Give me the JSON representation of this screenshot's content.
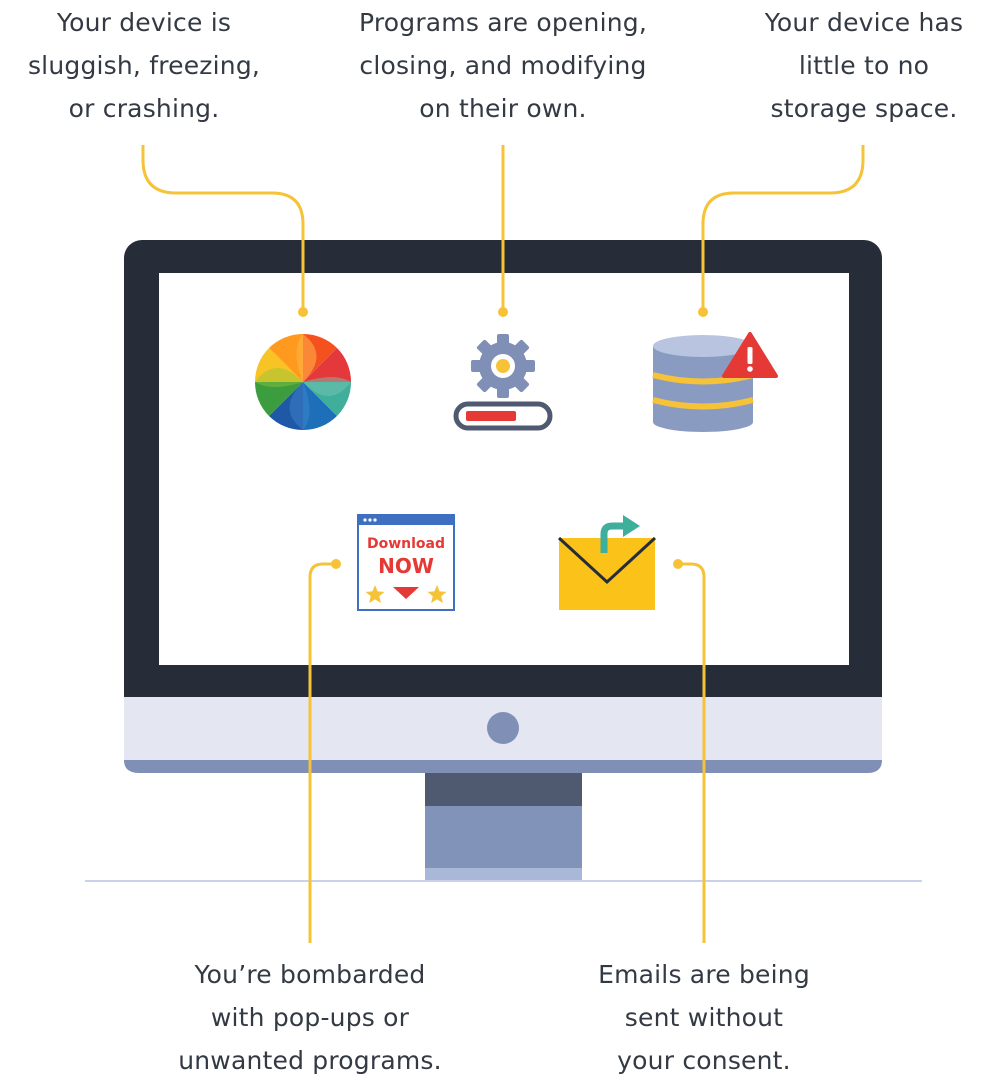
{
  "captions": {
    "slow": [
      "Your device is",
      "sluggish, freezing,",
      "or crashing."
    ],
    "programs": [
      "Programs are opening,",
      "closing, and modifying",
      "on their own."
    ],
    "storage": [
      "Your device has",
      "little to no",
      "storage space."
    ],
    "popups": [
      "You’re bombarded",
      "with pop-ups or",
      "unwanted programs."
    ],
    "emails": [
      "Emails are being",
      "sent without",
      "your consent."
    ]
  },
  "popup_window": {
    "line1": "Download",
    "line2": "NOW"
  },
  "icons": {
    "slow": "spinning-wheel-icon",
    "programs": "gear-progress-icon",
    "storage": "database-warning-icon",
    "popups": "download-popup-icon",
    "emails": "envelope-forward-icon"
  },
  "colors": {
    "leader_line": "#f6c338",
    "monitor_frame": "#262d39",
    "monitor_chin": "#e4e7f2",
    "stand": "#7f8fb6",
    "warning": "#e53935",
    "envelope": "#fbc21a"
  }
}
